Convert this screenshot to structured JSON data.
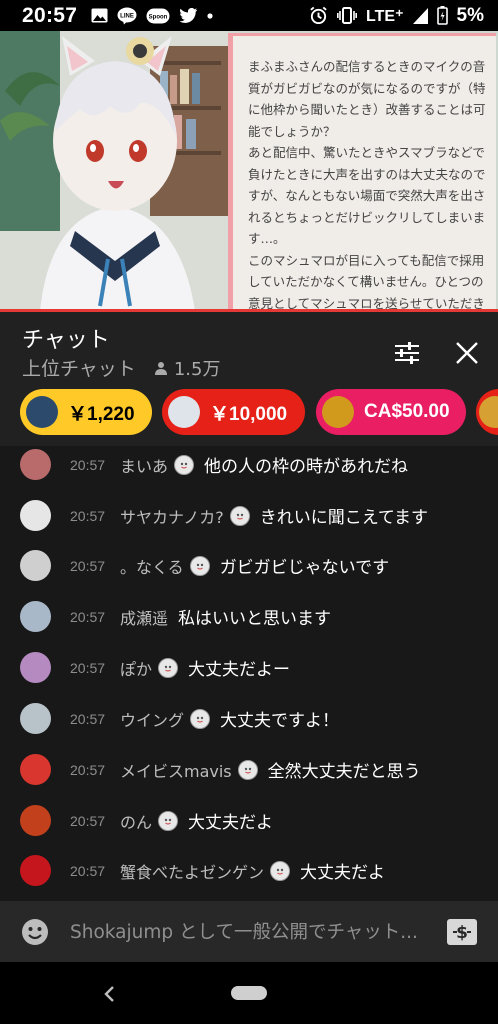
{
  "status_bar": {
    "time": "20:57",
    "network": "LTE⁺",
    "battery_percent": "5%",
    "left_icons": [
      "gallery-icon",
      "line-app-icon",
      "spoon-app-icon",
      "twitter-icon",
      "notification-dot-icon"
    ],
    "right_icons": [
      "alarm-icon",
      "vibrate-icon",
      "signal-icon",
      "battery-icon"
    ],
    "line_label": "LINE",
    "spoon_label": "Spoon"
  },
  "video": {
    "marshmallow_text": "まふまふさんの配信するときのマイクの音質がガビガビなのが気になるのですが（特に他枠から聞いたとき）改善することは可能でしょうか？\nあと配信中、驚いたときやスマブラなどで負けたときに大声を出すのは大丈夫なのですが、なんともない場面で突然大声を出されるとちょっとだけビックリしてしまいます…。\nこのマシュマロが目に入っても配信で採用していただかなくて構いません。ひとつの意見としてマシュマロを送らせていただきました。気分を害してしまったら申し訳ありません。\nこれからもまふまふさんの音楽、配信を楽しみ"
  },
  "chat_header": {
    "title": "チャット",
    "mode": "上位チャット",
    "viewer_count": "1.5万"
  },
  "ticker": [
    {
      "amount": "￥1,220",
      "color": "#ffca28",
      "text_color": "#000000",
      "avatar_color": "#2c4a6b"
    },
    {
      "amount": "￥10,000",
      "color": "#e62117",
      "text_color": "#ffffff",
      "avatar_color": "#dfe3ea"
    },
    {
      "amount": "CA$50.00",
      "color": "#e91e63",
      "text_color": "#ffffff",
      "avatar_color": "#d19a1c"
    },
    {
      "amount": "",
      "color": "#e62117",
      "text_color": "#ffffff",
      "avatar_color": "#d7a032"
    }
  ],
  "chat": [
    {
      "time": "20:57",
      "author": "まいあ",
      "message": "他の人の枠の時があれだね",
      "avatar_color": "#b96a6a"
    },
    {
      "time": "20:57",
      "author": "サヤカナノカ?",
      "message": "きれいに聞こえてます",
      "avatar_color": "#e6e6e6"
    },
    {
      "time": "20:57",
      "author": "。なくる",
      "message": "ガビガビじゃないです",
      "avatar_color": "#cfcfcf"
    },
    {
      "time": "20:57",
      "author": "成瀬遥",
      "message": "私はいいと思います",
      "avatar_color": "#a9b8c9"
    },
    {
      "time": "20:57",
      "author": "ぽか",
      "message": "大丈夫だよー",
      "avatar_color": "#b48ac1"
    },
    {
      "time": "20:57",
      "author": "ウイング",
      "message": "大丈夫ですよ！",
      "avatar_color": "#b7c3c9"
    },
    {
      "time": "20:57",
      "author": "メイビスmavis",
      "message": "全然大丈夫だと思う",
      "avatar_color": "#d8362e"
    },
    {
      "time": "20:57",
      "author": "のん",
      "message": "大丈夫だよ",
      "avatar_color": "#c2401c"
    },
    {
      "time": "20:57",
      "author": "蟹食べたよゼンゲン",
      "message": "大丈夫だよ",
      "avatar_color": "#c4161c"
    }
  ],
  "input": {
    "placeholder": "Shokajump として一般公開でチャット..."
  },
  "colors": {
    "accent_red": "#e53935",
    "header_bg": "#212121",
    "chat_bg": "#181818",
    "input_bg": "#282828"
  }
}
